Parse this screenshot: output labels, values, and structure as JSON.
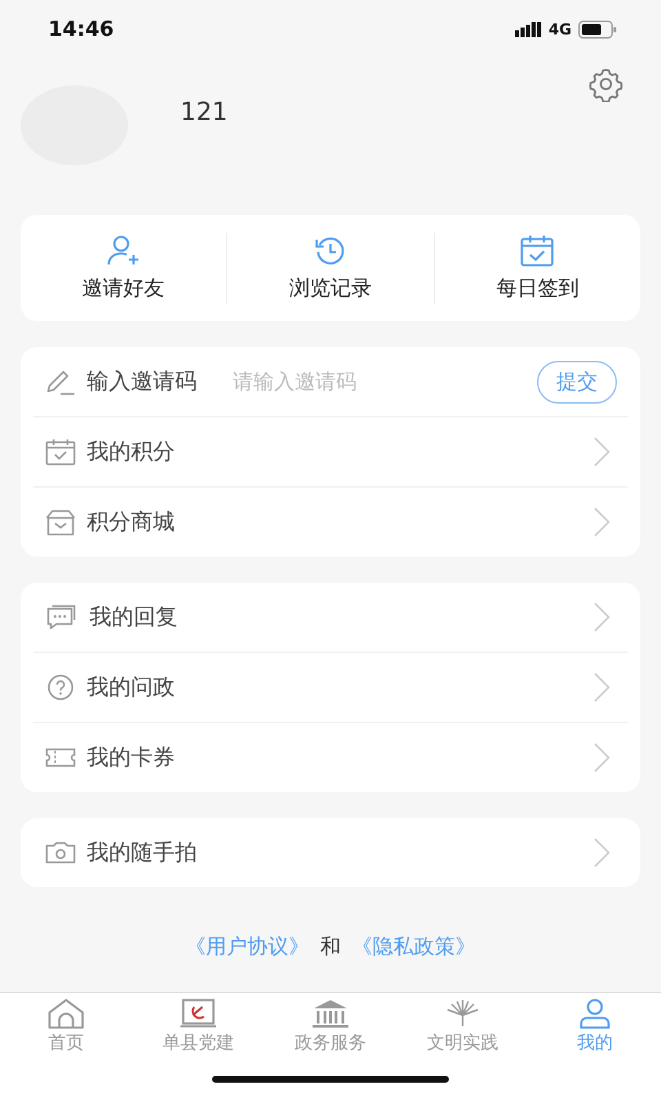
{
  "status_bar": {
    "time": "14:46",
    "network": "4G"
  },
  "profile": {
    "name": "121"
  },
  "quick_actions": [
    {
      "label": "邀请好友"
    },
    {
      "label": "浏览记录"
    },
    {
      "label": "每日签到"
    }
  ],
  "menu_groups": [
    {
      "items": [
        {
          "kind": "input",
          "label": "输入邀请码",
          "placeholder": "请输入邀请码",
          "button": "提交"
        },
        {
          "kind": "link",
          "label": "我的积分"
        },
        {
          "kind": "link",
          "label": "积分商城"
        }
      ]
    },
    {
      "items": [
        {
          "kind": "link",
          "label": "我的回复"
        },
        {
          "kind": "link",
          "label": "我的问政"
        },
        {
          "kind": "link",
          "label": "我的卡券"
        }
      ]
    },
    {
      "items": [
        {
          "kind": "link",
          "label": "我的随手拍"
        }
      ]
    }
  ],
  "footer_links": {
    "user_agreement": "《用户协议》",
    "conjunction": "和",
    "privacy_policy": "《隐私政策》"
  },
  "tab_bar": [
    {
      "label": "首页",
      "selected": false
    },
    {
      "label": "单县党建",
      "selected": false
    },
    {
      "label": "政务服务",
      "selected": false
    },
    {
      "label": "文明实践",
      "selected": false
    },
    {
      "label": "我的",
      "selected": true
    }
  ]
}
